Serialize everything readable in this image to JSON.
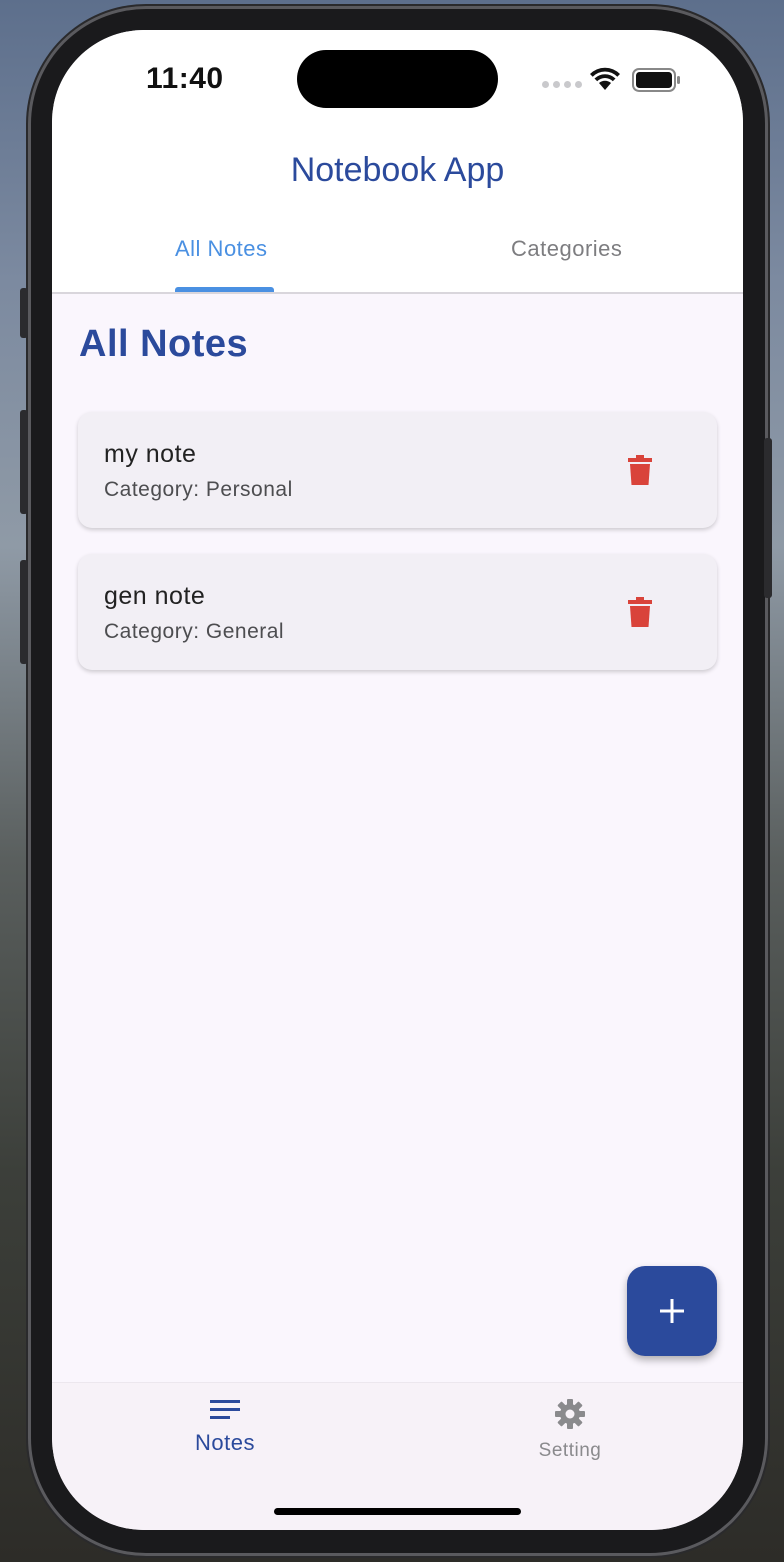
{
  "status_bar": {
    "time": "11:40",
    "icons": [
      "cellular-signal-icon",
      "wifi-icon",
      "battery-icon"
    ]
  },
  "app_bar": {
    "title": "Notebook App",
    "tabs": [
      {
        "label": "All Notes",
        "selected": true
      },
      {
        "label": "Categories",
        "selected": false
      }
    ]
  },
  "main": {
    "heading": "All Notes",
    "notes": [
      {
        "title": "my note",
        "category": "Category: Personal",
        "action_icon": "trash-icon"
      },
      {
        "title": "gen note",
        "category": "Category: General",
        "action_icon": "trash-icon"
      }
    ]
  },
  "fab": {
    "icon": "plus-icon"
  },
  "bottom_nav": {
    "items": [
      {
        "label": "Notes",
        "icon": "notes-lines-icon",
        "selected": true
      },
      {
        "label": "Setting",
        "icon": "gear-icon",
        "selected": false
      }
    ]
  },
  "colors": {
    "primary": "#2b4a9c",
    "tab_active": "#4a90e2",
    "delete": "#d9433a",
    "background": "#faf6fd",
    "card": "#f2eff5"
  }
}
